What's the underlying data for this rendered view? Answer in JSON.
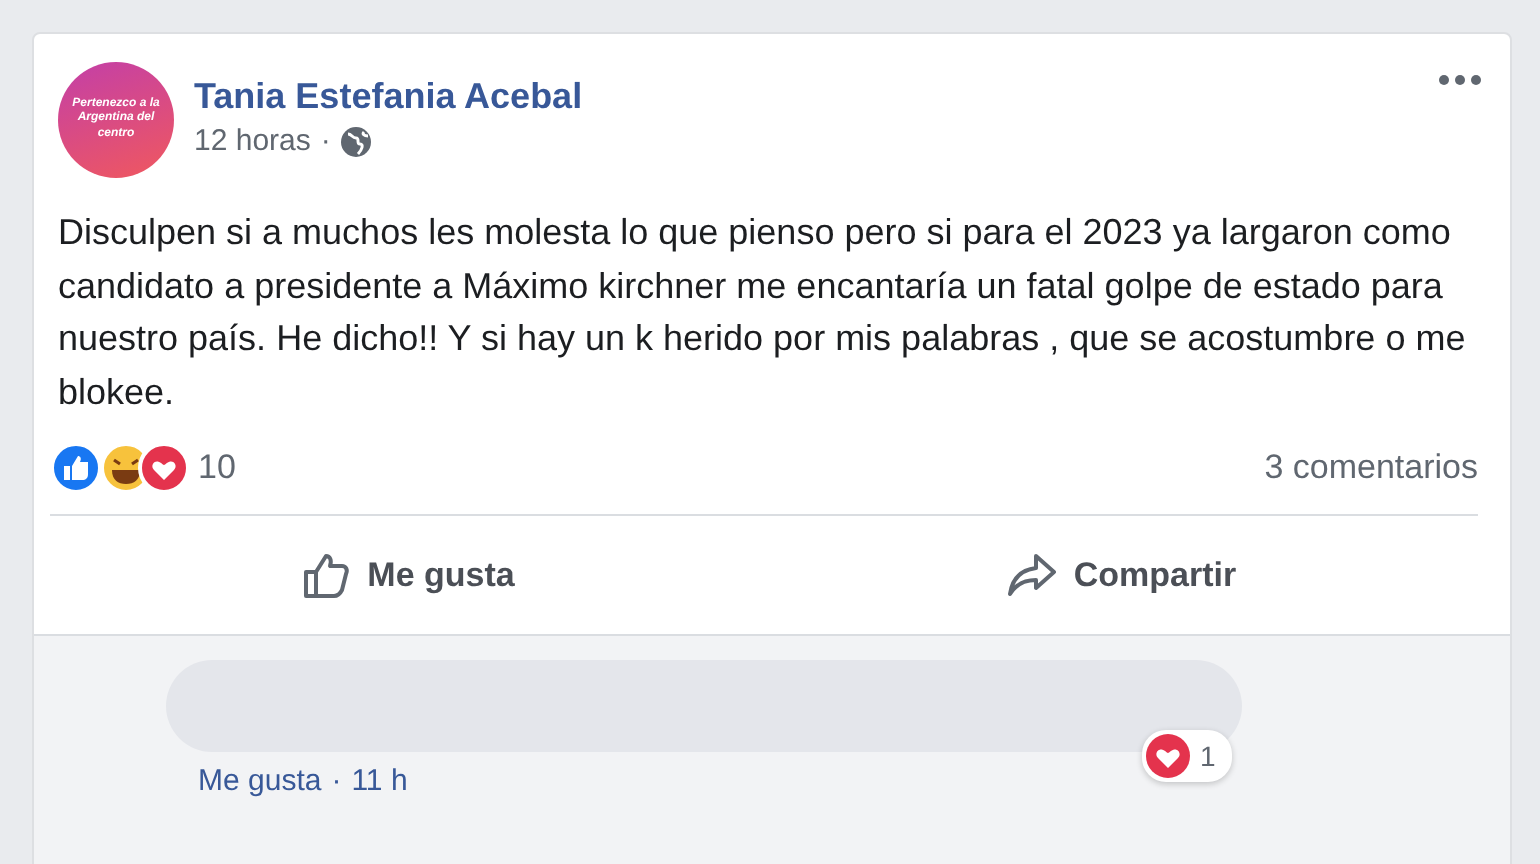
{
  "post": {
    "author": "Tania Estefania Acebal",
    "avatar_text": "Pertenezco a la Argentina del centro",
    "time": "12 horas",
    "separator": "·",
    "text": "Disculpen si a muchos les molesta lo que pienso pero si para el 2023 ya largaron como candidato a presidente a Máximo kirchner me encantaría un fatal golpe de estado para nuestro país. He dicho!! Y si hay un k herido por mis palabras , que se acostumbre o me blokee."
  },
  "reactions": {
    "count": "10",
    "comments": "3 comentarios"
  },
  "actions": [
    {
      "kind": "like",
      "label": "Me gusta"
    },
    {
      "kind": "share",
      "label": "Compartir"
    }
  ],
  "comment": {
    "like": "Me gusta",
    "separator": "·",
    "time": "11 h",
    "reaction_count": "1"
  }
}
